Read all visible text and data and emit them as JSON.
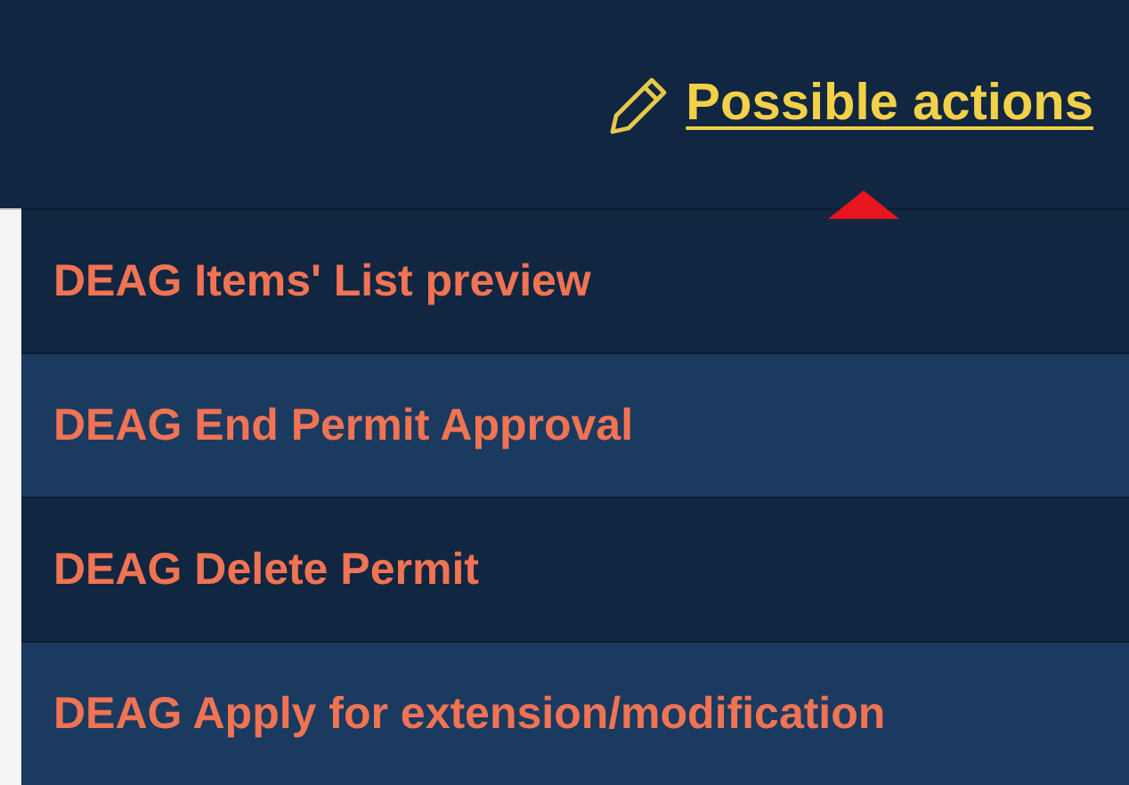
{
  "header": {
    "action_link": "Possible actions"
  },
  "menu": {
    "items": [
      {
        "label": "DEAG Items' List preview"
      },
      {
        "label": "DEAG End Permit Approval"
      },
      {
        "label": "DEAG Delete Permit"
      },
      {
        "label": "DEAG Apply for extension/modification"
      }
    ]
  }
}
